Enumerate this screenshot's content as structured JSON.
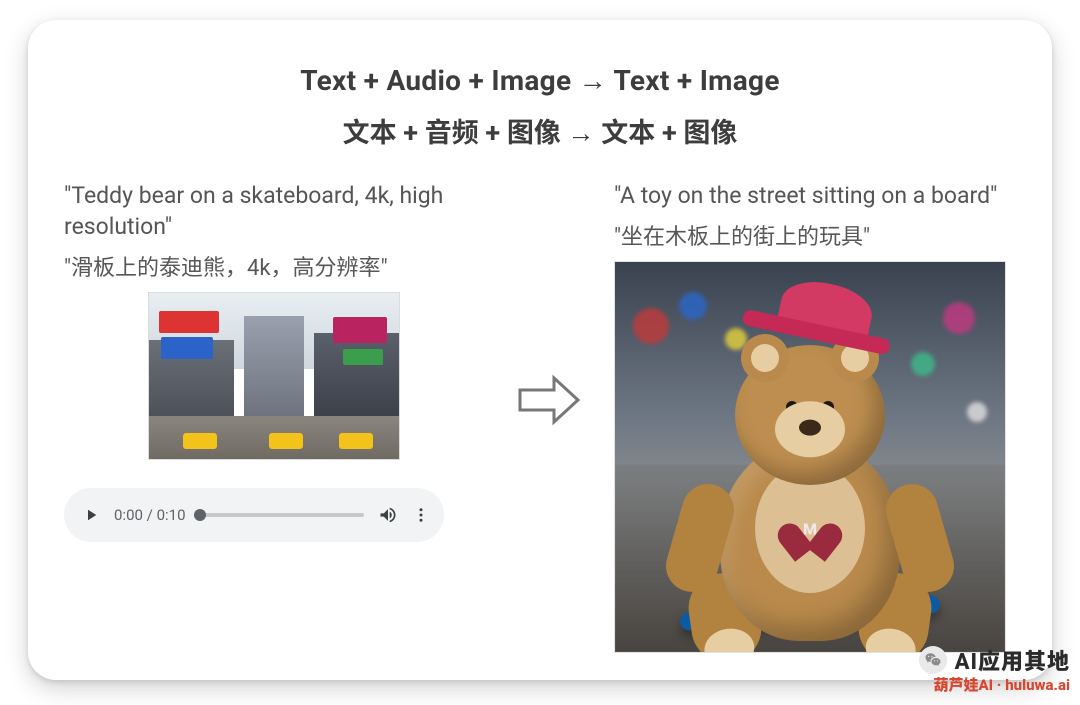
{
  "headings": {
    "line1": "Text + Audio + Image → Text + Image",
    "line2": "文本 + 音频 + 图像 → 文本 + 图像"
  },
  "input": {
    "prompt_en": "\"Teddy bear on a skateboard, 4k, high resolution\"",
    "prompt_zh": "\"滑板上的泰迪熊，4k，高分辨率\"",
    "image_alt": "times-square-street-photo"
  },
  "audio": {
    "current_time": "0:00",
    "duration": "0:10",
    "separator": " / "
  },
  "output": {
    "caption_en": "\"A toy on the street sitting on a board\"",
    "caption_zh": "\"坐在木板上的街上的玩具\"",
    "image_alt": "teddy-bear-with-red-hat-on-skateboard-in-rainy-street"
  },
  "watermark": {
    "line1": "AI应用其地",
    "line2": "葫芦娃AI  ·  huluwa.ai"
  }
}
